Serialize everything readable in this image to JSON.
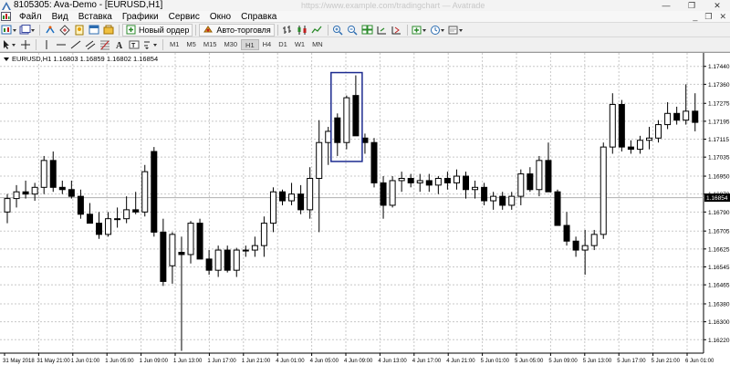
{
  "window": {
    "title": "8105305: Ava-Demo - [EURUSD,H1]",
    "ghost_title": "https://www.example.com/tradingchart — Avatrade",
    "controls": [
      "—",
      "❐",
      "✕"
    ]
  },
  "menu": {
    "items": [
      "Файл",
      "Вид",
      "Вставка",
      "Графики",
      "Сервис",
      "Окно",
      "Справка"
    ],
    "window_controls": [
      "_",
      "❐",
      "✕"
    ]
  },
  "toolbar": {
    "new_order_label": "Новый ордер",
    "auto_trading_label": "Авто-торговля"
  },
  "timeframes": {
    "items": [
      "M1",
      "M5",
      "M15",
      "M30",
      "H1",
      "H4",
      "D1",
      "W1",
      "MN"
    ],
    "active": "H1"
  },
  "chart": {
    "symbol_line": "EURUSD,H1  1.16803 1.16859 1.16802 1.16854",
    "current_price_label": "1.16854",
    "price_ticks": [
      "1.17440",
      "1.17360",
      "1.17275",
      "1.17195",
      "1.17115",
      "1.17035",
      "1.16950",
      "1.16870",
      "1.16790",
      "1.16705",
      "1.16625",
      "1.16545",
      "1.16465",
      "1.16380",
      "1.16300",
      "1.16220"
    ],
    "time_ticks": [
      "31 May 2018",
      "31 May 21:00",
      "1 Jun 01:00",
      "1 Jun 05:00",
      "1 Jun 09:00",
      "1 Jun 13:00",
      "1 Jun 17:00",
      "1 Jun 21:00",
      "4 Jun 01:00",
      "4 Jun 05:00",
      "4 Jun 09:00",
      "4 Jun 13:00",
      "4 Jun 17:00",
      "4 Jun 21:00",
      "5 Jun 01:00",
      "5 Jun 05:00",
      "5 Jun 09:00",
      "5 Jun 13:00",
      "5 Jun 17:00",
      "5 Jun 21:00",
      "6 Jun 01:00"
    ],
    "colors": {
      "bull": "#ffffff",
      "bear": "#000000",
      "wick": "#000000",
      "grid": "#c8c8c8",
      "highlight": "#1c2b8f",
      "current_price_bg": "#000000"
    }
  },
  "chart_data": {
    "type": "candlestick",
    "symbol": "EURUSD",
    "timeframe": "H1",
    "last_quote": {
      "open": 1.16803,
      "high": 1.16859,
      "low": 1.16802,
      "close": 1.16854
    },
    "ylim": [
      1.1616,
      1.175
    ],
    "grid": true,
    "candles": [
      [
        1.1679,
        1.1687,
        1.1674,
        1.1685
      ],
      [
        1.1685,
        1.1691,
        1.1681,
        1.1688
      ],
      [
        1.1688,
        1.1693,
        1.1685,
        1.1687
      ],
      [
        1.1687,
        1.1692,
        1.1684,
        1.169
      ],
      [
        1.169,
        1.1704,
        1.1687,
        1.1702
      ],
      [
        1.1702,
        1.1706,
        1.1688,
        1.169
      ],
      [
        1.169,
        1.1693,
        1.1687,
        1.1689
      ],
      [
        1.1689,
        1.1693,
        1.1685,
        1.1686
      ],
      [
        1.1686,
        1.1689,
        1.1676,
        1.1678
      ],
      [
        1.1678,
        1.1683,
        1.1674,
        1.1674
      ],
      [
        1.1674,
        1.1679,
        1.1667,
        1.1669
      ],
      [
        1.1669,
        1.1679,
        1.1668,
        1.1676
      ],
      [
        1.1676,
        1.1681,
        1.1672,
        1.1676
      ],
      [
        1.1676,
        1.1686,
        1.1674,
        1.168
      ],
      [
        1.168,
        1.1688,
        1.1678,
        1.1679
      ],
      [
        1.1679,
        1.17,
        1.1677,
        1.1697
      ],
      [
        1.1706,
        1.1708,
        1.1668,
        1.167
      ],
      [
        1.167,
        1.1676,
        1.1646,
        1.1648
      ],
      [
        1.1655,
        1.167,
        1.1647,
        1.1669
      ],
      [
        1.1661,
        1.1668,
        1.1617,
        1.166
      ],
      [
        1.166,
        1.1675,
        1.1656,
        1.1674
      ],
      [
        1.1674,
        1.1676,
        1.1658,
        1.1658
      ],
      [
        1.1658,
        1.1662,
        1.1651,
        1.1653
      ],
      [
        1.1653,
        1.1664,
        1.165,
        1.1662
      ],
      [
        1.1662,
        1.1664,
        1.1652,
        1.1653
      ],
      [
        1.1653,
        1.1663,
        1.165,
        1.1662
      ],
      [
        1.1662,
        1.1664,
        1.1659,
        1.1662
      ],
      [
        1.1662,
        1.1668,
        1.1659,
        1.1664
      ],
      [
        1.1664,
        1.1677,
        1.1659,
        1.1674
      ],
      [
        1.1674,
        1.169,
        1.167,
        1.1688
      ],
      [
        1.1688,
        1.1689,
        1.1682,
        1.1684
      ],
      [
        1.1684,
        1.1692,
        1.1682,
        1.1687
      ],
      [
        1.1687,
        1.1691,
        1.1678,
        1.168
      ],
      [
        1.168,
        1.1699,
        1.1676,
        1.1694
      ],
      [
        1.1694,
        1.172,
        1.167,
        1.171
      ],
      [
        1.171,
        1.1717,
        1.17,
        1.1715
      ],
      [
        1.1721,
        1.1723,
        1.1704,
        1.171
      ],
      [
        1.171,
        1.1731,
        1.1707,
        1.173
      ],
      [
        1.1731,
        1.174,
        1.1713,
        1.1713
      ],
      [
        1.1712,
        1.1714,
        1.1705,
        1.171
      ],
      [
        1.171,
        1.1712,
        1.169,
        1.1692
      ],
      [
        1.1692,
        1.1695,
        1.1676,
        1.1682
      ],
      [
        1.1682,
        1.1695,
        1.1681,
        1.1693
      ],
      [
        1.1693,
        1.1697,
        1.1688,
        1.1694
      ],
      [
        1.1694,
        1.1696,
        1.169,
        1.1692
      ],
      [
        1.1692,
        1.1696,
        1.1688,
        1.1693
      ],
      [
        1.1693,
        1.1696,
        1.1688,
        1.1691
      ],
      [
        1.1691,
        1.1695,
        1.1687,
        1.1694
      ],
      [
        1.1694,
        1.1697,
        1.1689,
        1.1692
      ],
      [
        1.1692,
        1.1698,
        1.1689,
        1.1695
      ],
      [
        1.1695,
        1.1697,
        1.1685,
        1.1689
      ],
      [
        1.1689,
        1.1693,
        1.1685,
        1.169
      ],
      [
        1.169,
        1.1692,
        1.1682,
        1.1684
      ],
      [
        1.1684,
        1.1688,
        1.168,
        1.1686
      ],
      [
        1.1686,
        1.1688,
        1.168,
        1.1682
      ],
      [
        1.1682,
        1.1688,
        1.168,
        1.1686
      ],
      [
        1.1686,
        1.1698,
        1.1682,
        1.1696
      ],
      [
        1.1696,
        1.1699,
        1.1688,
        1.1689
      ],
      [
        1.1689,
        1.1704,
        1.1686,
        1.1702
      ],
      [
        1.1702,
        1.171,
        1.1688,
        1.1688
      ],
      [
        1.1688,
        1.1689,
        1.1673,
        1.1673
      ],
      [
        1.1673,
        1.1679,
        1.1664,
        1.1666
      ],
      [
        1.1666,
        1.1668,
        1.1659,
        1.1662
      ],
      [
        1.1662,
        1.1671,
        1.1651,
        1.1664
      ],
      [
        1.1664,
        1.1671,
        1.1662,
        1.1669
      ],
      [
        1.1669,
        1.171,
        1.1667,
        1.1708
      ],
      [
        1.1708,
        1.1732,
        1.1705,
        1.1727
      ],
      [
        1.1727,
        1.1729,
        1.1706,
        1.1708
      ],
      [
        1.1708,
        1.1711,
        1.1705,
        1.1707
      ],
      [
        1.1707,
        1.1713,
        1.1705,
        1.1711
      ],
      [
        1.1711,
        1.1717,
        1.1707,
        1.1712
      ],
      [
        1.1712,
        1.172,
        1.171,
        1.1718
      ],
      [
        1.1718,
        1.1728,
        1.1716,
        1.1723
      ],
      [
        1.1723,
        1.1726,
        1.1718,
        1.172
      ],
      [
        1.172,
        1.1736,
        1.1718,
        1.1724
      ],
      [
        1.1724,
        1.1732,
        1.1715,
        1.1719
      ]
    ],
    "highlight_range": {
      "from_index": 36,
      "to_index": 38
    }
  }
}
